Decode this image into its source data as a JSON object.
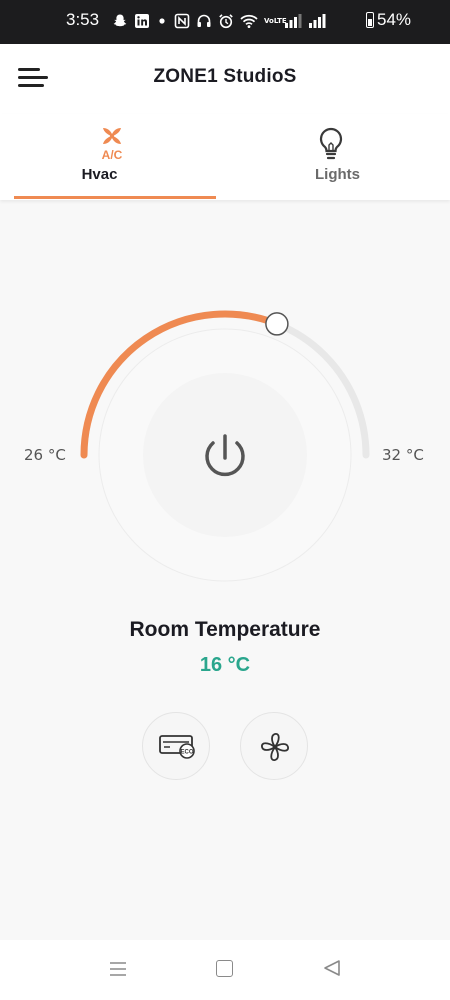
{
  "status_bar": {
    "time": "3:53",
    "battery": "54%",
    "icons": [
      "snapchat-icon",
      "linkedin-icon",
      "dot-icon",
      "nfc-icon",
      "headphones-icon",
      "alarm-icon",
      "wifi-icon",
      "volte-icon",
      "signal-1-icon",
      "signal-2-icon",
      "battery-icon"
    ],
    "volte_text": "VoLTE"
  },
  "app_bar": {
    "title": "ZONE1 StudioS",
    "menu_icon": "menu-icon"
  },
  "tabs": [
    {
      "label": "Hvac",
      "icon": "ac-fan-icon",
      "icon_text": "A/C",
      "active": true
    },
    {
      "label": "Lights",
      "icon": "bulb-icon",
      "active": false
    }
  ],
  "thermostat": {
    "min_label": "26 °C",
    "max_label": "32 °C",
    "setpoint_fraction": 0.62,
    "power_icon": "power-icon",
    "accent_color": "#ef8a52",
    "track_color": "#e8e8e8"
  },
  "room": {
    "label": "Room Temperature",
    "value": "16 °C",
    "value_color": "#2aa68d"
  },
  "controls": [
    {
      "name": "eco-mode-button",
      "icon": "eco-ac-icon",
      "icon_text": "ECO"
    },
    {
      "name": "fan-button",
      "icon": "fan-icon"
    }
  ],
  "nav_bar": {
    "icons": [
      "recents-icon",
      "home-icon",
      "back-icon"
    ]
  }
}
